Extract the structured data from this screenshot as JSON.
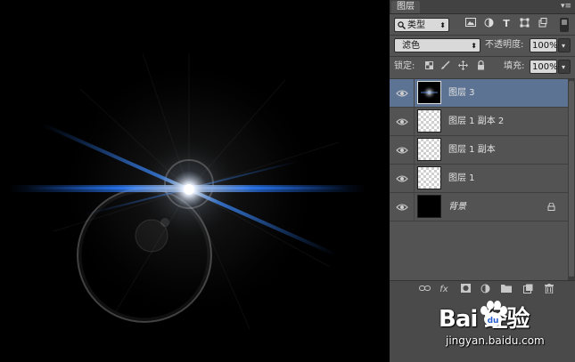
{
  "panel": {
    "tab_title": "图层",
    "menu_glyph": "▾≡"
  },
  "filter_row": {
    "kind_label": "类型",
    "kind_icon": "search-icon"
  },
  "blend_row": {
    "blend_mode": "滤色",
    "opacity_label": "不透明度:",
    "opacity_value": "100%"
  },
  "lock_row": {
    "lock_label": "锁定:",
    "fill_label": "填充:",
    "fill_value": "100%"
  },
  "layers": [
    {
      "name": "图层 3",
      "selected": true,
      "thumb": "flare",
      "locked": false
    },
    {
      "name": "图层 1 副本 2",
      "selected": false,
      "thumb": "transparent",
      "locked": false
    },
    {
      "name": "图层 1 副本",
      "selected": false,
      "thumb": "transparent",
      "locked": false
    },
    {
      "name": "图层 1",
      "selected": false,
      "thumb": "transparent",
      "locked": false
    },
    {
      "name": "背景",
      "selected": false,
      "thumb": "black",
      "locked": true
    }
  ],
  "bottom_buttons": {
    "fx_label": "fx"
  },
  "watermark": {
    "brand": "Bai 经验",
    "url": "jingyan.baidu.com"
  },
  "colors": {
    "selected_layer": "#5d7393",
    "panel_bg": "#535353",
    "flare_blue": "#3a8cff"
  }
}
